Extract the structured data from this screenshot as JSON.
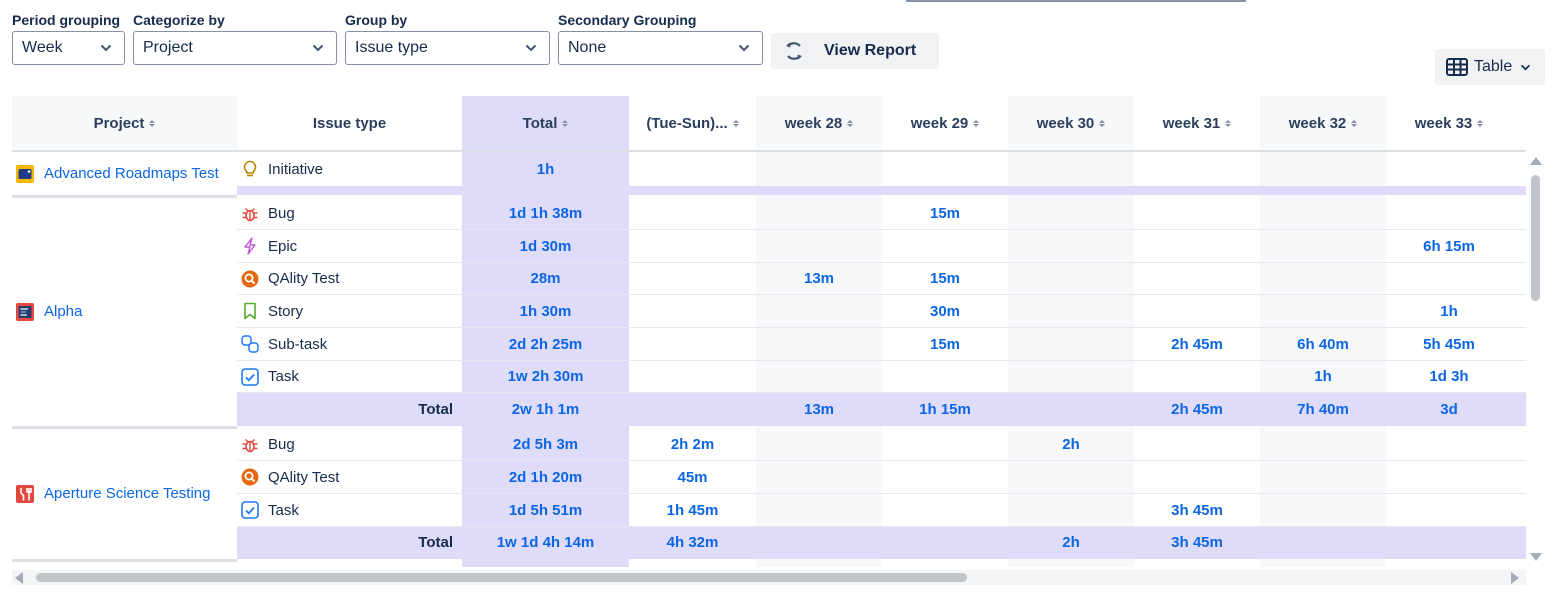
{
  "filters": {
    "period": {
      "label": "Period grouping",
      "value": "Week"
    },
    "categorize": {
      "label": "Categorize by",
      "value": "Project"
    },
    "group": {
      "label": "Group by",
      "value": "Issue type"
    },
    "secondary": {
      "label": "Secondary Grouping",
      "value": "None"
    }
  },
  "actions": {
    "view_report": "View Report",
    "table": "Table"
  },
  "colors": {
    "accent": "#0c66e4",
    "total_band": "#dfdcfa",
    "weekend_col": "#f7f8f9"
  },
  "table": {
    "headers": {
      "project": "Project",
      "issue_type": "Issue type",
      "total": "Total",
      "weeks": [
        "(Tue-Sun)...",
        "week 28",
        "week 29",
        "week 30",
        "week 31",
        "week 32",
        "week 33"
      ]
    },
    "groups": [
      {
        "project": "Advanced Roadmaps Test",
        "project_icon": "roadmap-project-icon",
        "rows": [
          {
            "type": "Initiative",
            "icon": "lightbulb-icon",
            "total": "1h",
            "weeks": [
              "",
              "",
              "",
              "",
              "",
              "",
              ""
            ]
          }
        ],
        "footer": null
      },
      {
        "project": "Alpha",
        "project_icon": "code-project-icon",
        "rows": [
          {
            "type": "Bug",
            "icon": "bug-icon",
            "total": "1d 1h 38m",
            "weeks": [
              "",
              "",
              "15m",
              "",
              "",
              "",
              ""
            ]
          },
          {
            "type": "Epic",
            "icon": "epic-icon",
            "total": "1d 30m",
            "weeks": [
              "",
              "",
              "",
              "",
              "",
              "",
              "6h 15m"
            ]
          },
          {
            "type": "QAlity Test",
            "icon": "qality-test-icon",
            "total": "28m",
            "weeks": [
              "",
              "13m",
              "15m",
              "",
              "",
              "",
              ""
            ]
          },
          {
            "type": "Story",
            "icon": "story-bookmark-icon",
            "total": "1h 30m",
            "weeks": [
              "",
              "",
              "30m",
              "",
              "",
              "",
              "1h"
            ]
          },
          {
            "type": "Sub-task",
            "icon": "subtask-icon",
            "total": "2d 2h 25m",
            "weeks": [
              "",
              "",
              "15m",
              "",
              "2h 45m",
              "6h 40m",
              "5h 45m"
            ]
          },
          {
            "type": "Task",
            "icon": "task-checkbox-icon",
            "total": "1w 2h 30m",
            "weeks": [
              "",
              "",
              "",
              "",
              "",
              "1h",
              "1d 3h"
            ]
          }
        ],
        "footer": {
          "label": "Total",
          "total": "2w 1h 1m",
          "weeks": [
            "",
            "13m",
            "1h 15m",
            "",
            "2h 45m",
            "7h 40m",
            "3d"
          ]
        }
      },
      {
        "project": "Aperture Science Testing",
        "project_icon": "wrench-project-icon",
        "rows": [
          {
            "type": "Bug",
            "icon": "bug-icon",
            "total": "2d 5h 3m",
            "weeks": [
              "2h 2m",
              "",
              "",
              "2h",
              "",
              "",
              ""
            ]
          },
          {
            "type": "QAlity Test",
            "icon": "qality-test-icon",
            "total": "2d 1h 20m",
            "weeks": [
              "45m",
              "",
              "",
              "",
              "",
              "",
              ""
            ]
          },
          {
            "type": "Task",
            "icon": "task-checkbox-icon",
            "total": "1d 5h 51m",
            "weeks": [
              "1h 45m",
              "",
              "",
              "",
              "3h 45m",
              "",
              ""
            ]
          }
        ],
        "footer": {
          "label": "Total",
          "total": "1w 1d 4h 14m",
          "weeks": [
            "4h 32m",
            "",
            "",
            "2h",
            "3h 45m",
            "",
            ""
          ]
        }
      }
    ]
  }
}
